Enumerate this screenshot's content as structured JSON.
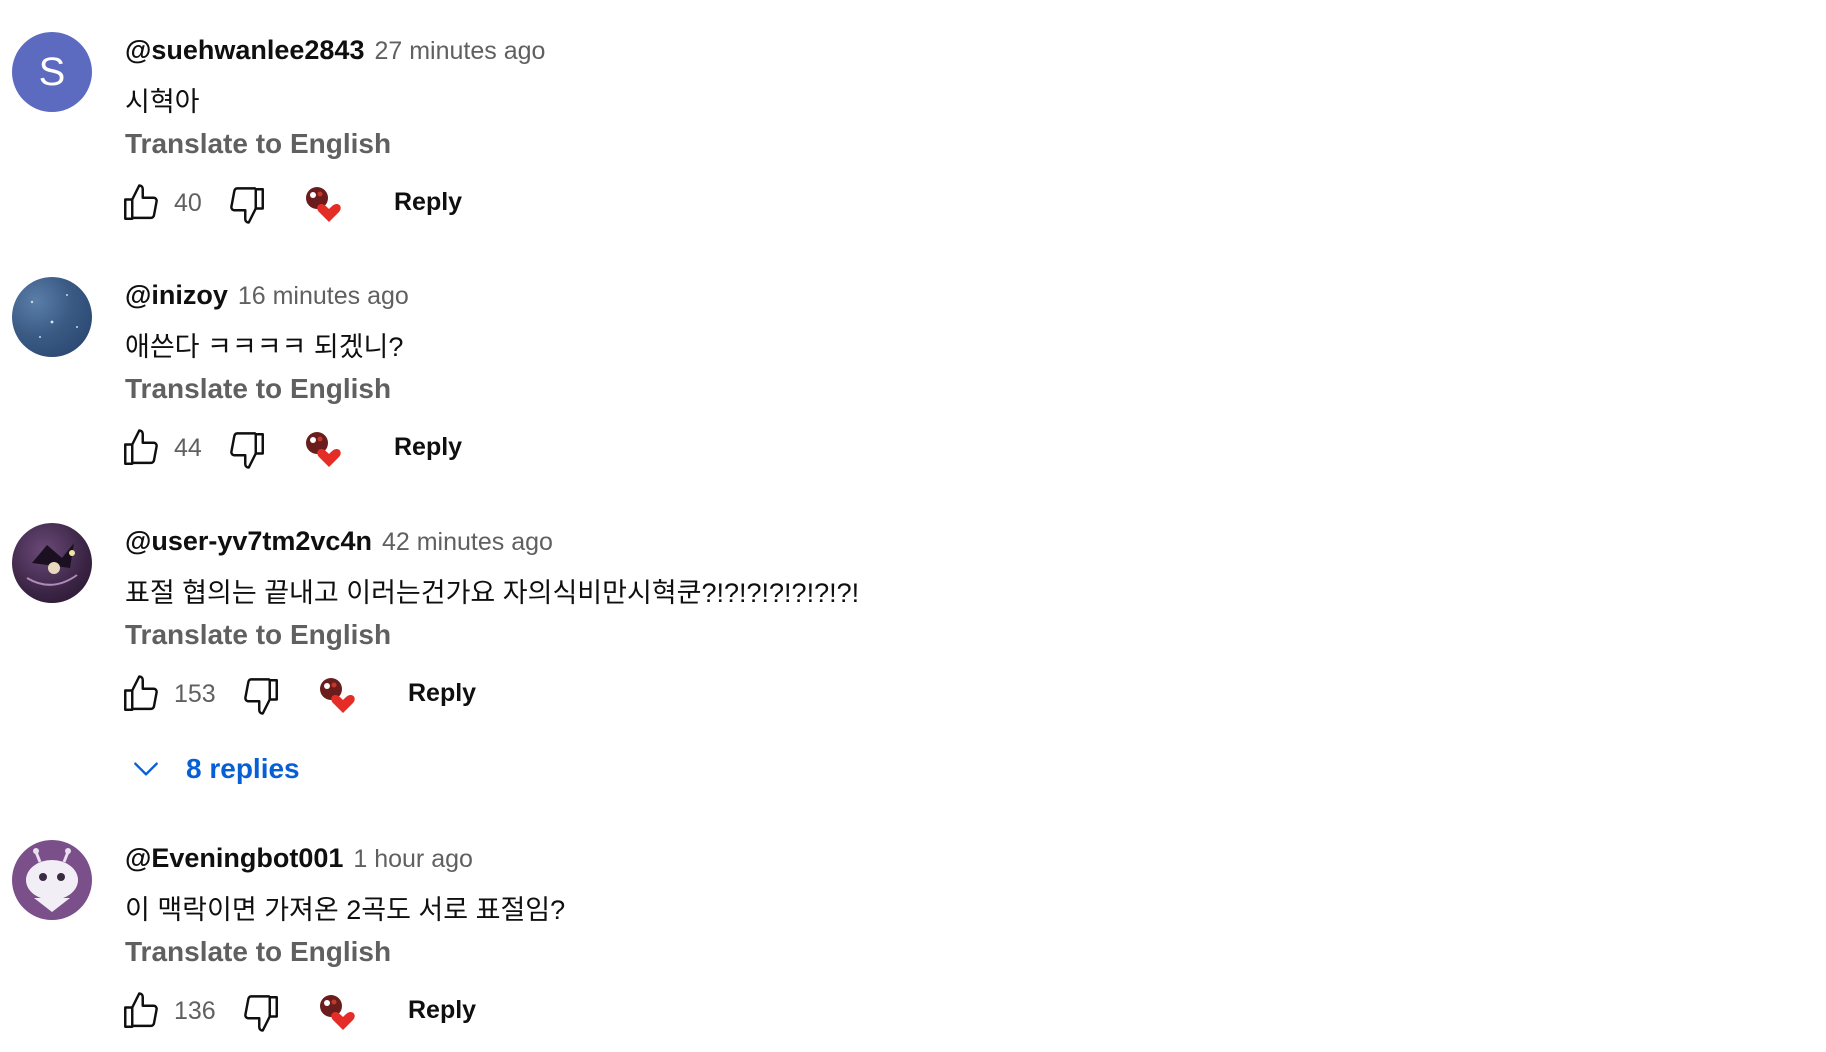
{
  "comments": [
    {
      "author": "@suehwanlee2843",
      "time": "27 minutes ago",
      "text": "시혁아",
      "translate": "Translate to English",
      "likes": "40",
      "reply": "Reply",
      "avatar_letter": "S",
      "avatar_color": "#5c6bc0"
    },
    {
      "author": "@inizoy",
      "time": "16 minutes ago",
      "text": "애쓴다 ㅋㅋㅋㅋ 되겠니?",
      "translate": "Translate to English",
      "likes": "44",
      "reply": "Reply"
    },
    {
      "author": "@user-yv7tm2vc4n",
      "time": "42 minutes ago",
      "text": "표절 협의는 끝내고 이러는건가요 자의식비만시혁쿤?!?!?!?!?!?!?!",
      "translate": "Translate to English",
      "likes": "153",
      "reply": "Reply",
      "replies": "8 replies"
    },
    {
      "author": "@Eveningbot001",
      "time": "1 hour ago",
      "text": "이 맥락이면 가져온 2곡도 서로 표절임?",
      "translate": "Translate to English",
      "likes": "136",
      "reply": "Reply"
    }
  ],
  "colors": {
    "link_blue": "#065fd4",
    "muted_text": "#606060",
    "heart_red": "#e52d27"
  },
  "icons": {
    "like": "thumb-up-icon",
    "dislike": "thumb-down-icon",
    "creator_heart": "creator-heart-icon",
    "expand": "chevron-down-icon"
  }
}
